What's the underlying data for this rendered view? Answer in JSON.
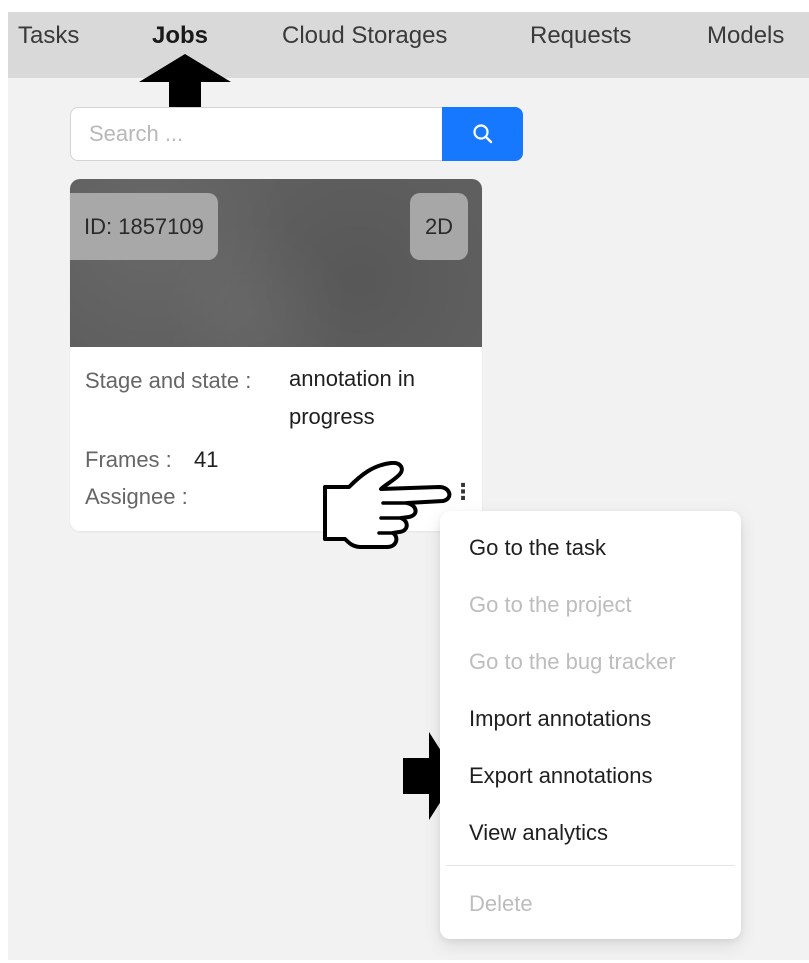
{
  "nav": {
    "tabs": [
      {
        "label": "Tasks",
        "active": false
      },
      {
        "label": "Jobs",
        "active": true
      },
      {
        "label": "Cloud Storages",
        "active": false
      },
      {
        "label": "Requests",
        "active": false
      },
      {
        "label": "Models",
        "active": false
      }
    ]
  },
  "search": {
    "placeholder": "Search ...",
    "button_icon": "search-icon"
  },
  "job_card": {
    "id_label": "ID: 1857109",
    "dimension": "2D",
    "stage_label": "Stage and state",
    "stage_value": "annotation in progress",
    "frames_label": "Frames",
    "frames_value": "41",
    "assignee_label": "Assignee",
    "more_icon": "more-vertical-icon"
  },
  "menu": {
    "items": [
      {
        "label": "Go to the task",
        "disabled": false
      },
      {
        "label": "Go to the project",
        "disabled": true
      },
      {
        "label": "Go to the bug tracker",
        "disabled": true
      },
      {
        "label": "Import annotations",
        "disabled": false
      },
      {
        "label": "Export annotations",
        "disabled": false
      },
      {
        "label": "View analytics",
        "disabled": false
      },
      {
        "label": "Delete",
        "disabled": true
      }
    ]
  },
  "colors": {
    "accent": "#1677ff",
    "nav_bg": "#d9d9d9",
    "page_bg": "#f2f2f2",
    "disabled_text": "#bdbdbd"
  }
}
